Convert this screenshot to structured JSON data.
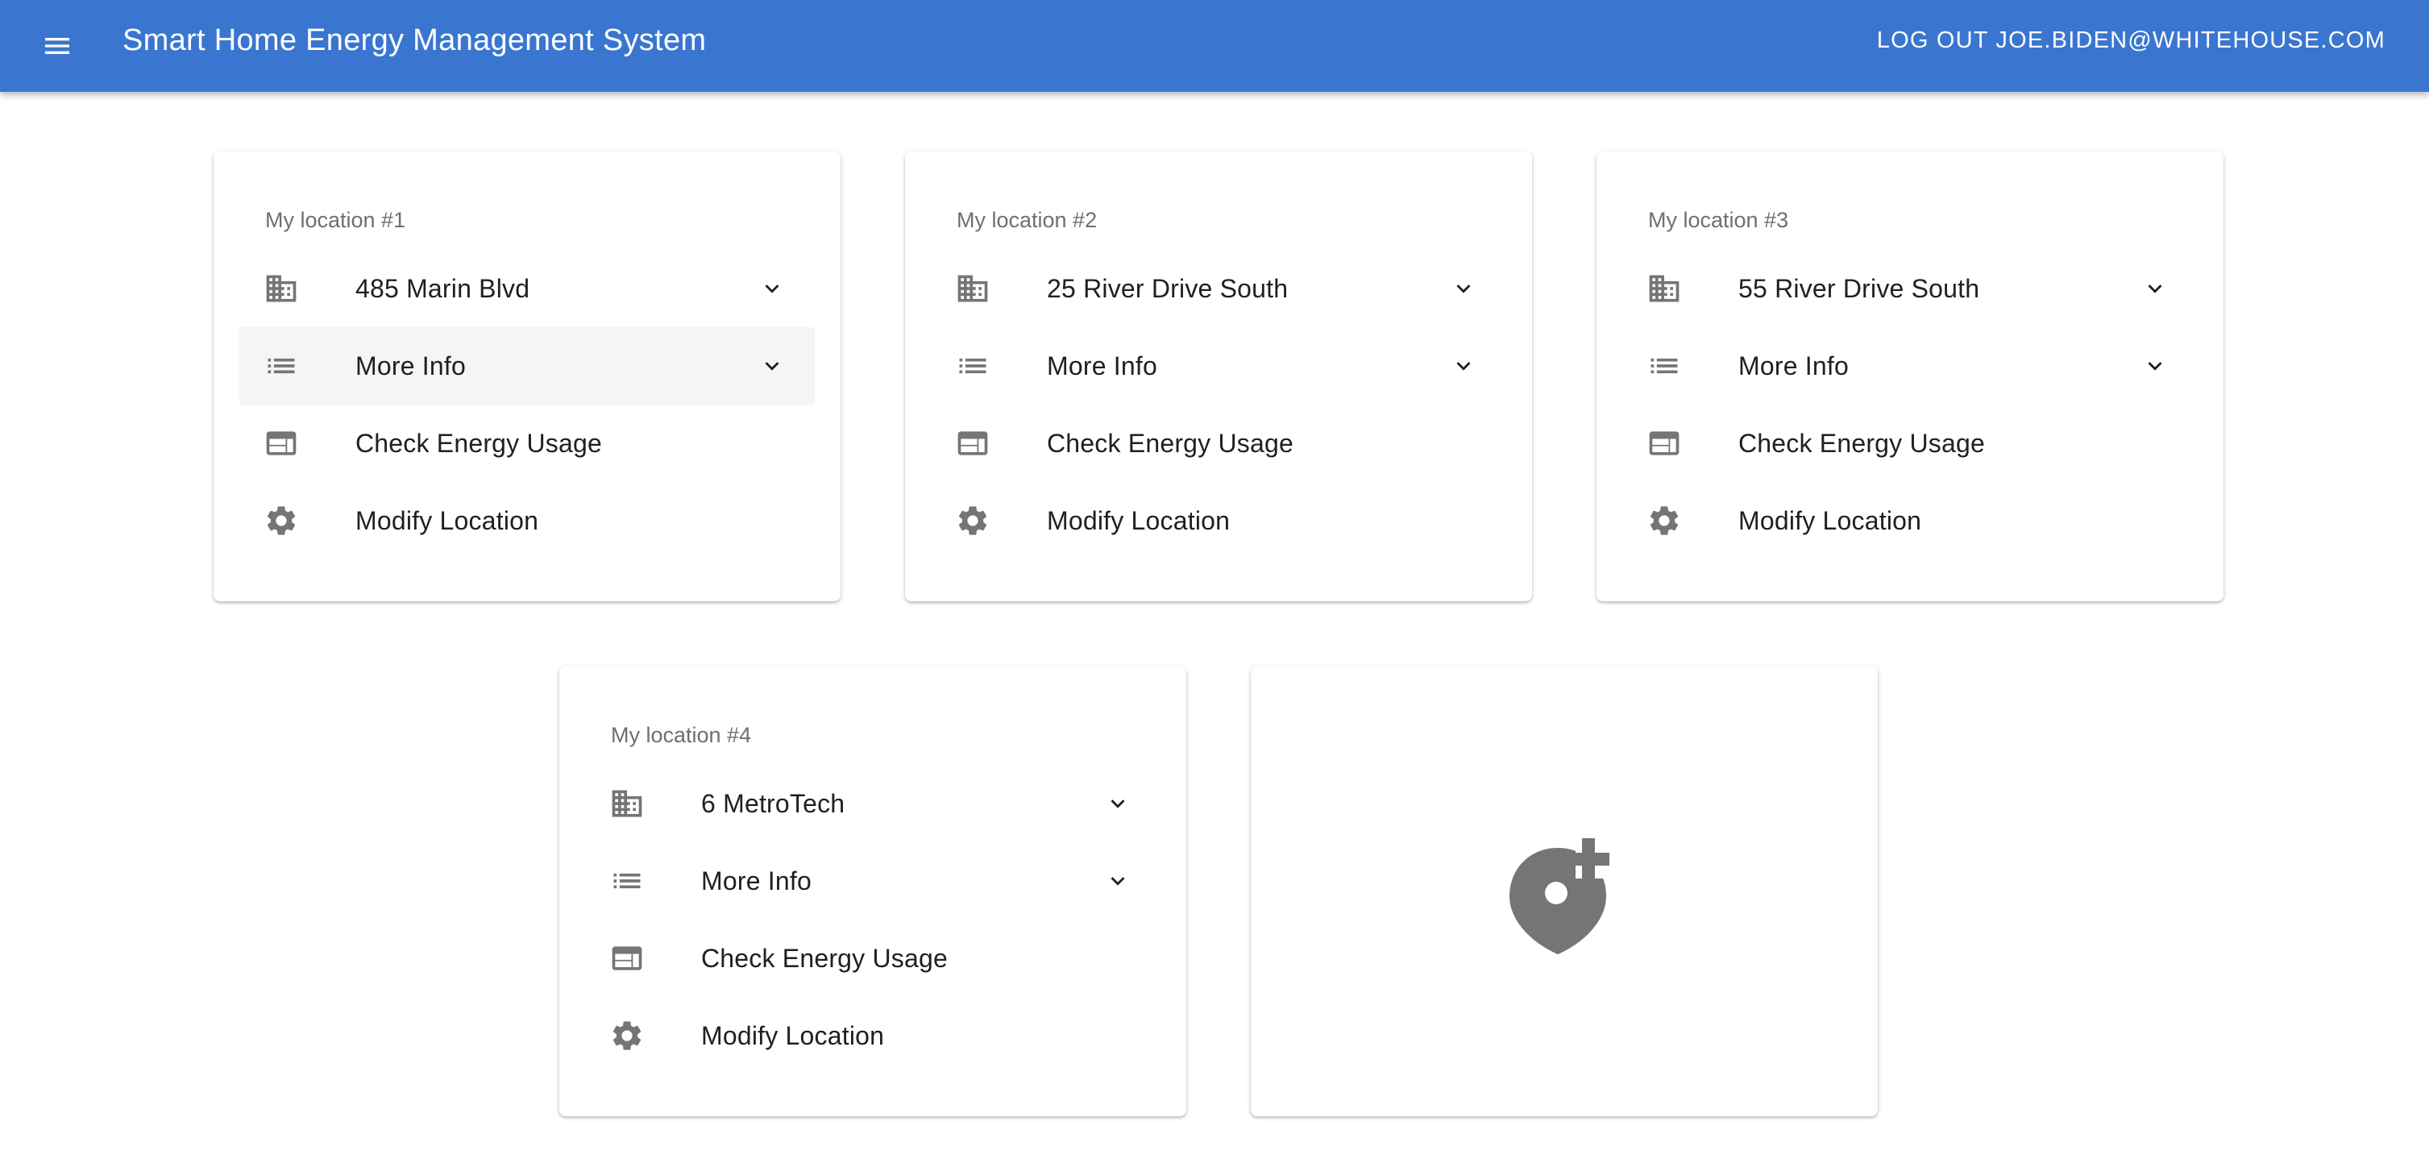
{
  "app": {
    "title": "Smart Home Energy Management System",
    "logout_label": "LOG OUT",
    "user_email": "JOE.BIDEN@WHITEHOUSE.COM"
  },
  "colors": {
    "appbar": "#3a76cf",
    "icon": "#757575",
    "card_title": "#6f6f6f",
    "active_row": "#f5f5f5"
  },
  "icons": {
    "menu": "menu-icon",
    "address": "building-icon",
    "more_info": "list-icon",
    "energy": "web-panel-icon",
    "modify": "gear-icon",
    "expand": "chevron-down-icon",
    "add_location": "add-location-icon"
  },
  "cards": [
    {
      "title": "My location #1",
      "address": "485 Marin Blvd",
      "more_info": "More Info",
      "check_energy": "Check Energy Usage",
      "modify": "Modify Location"
    },
    {
      "title": "My location #2",
      "address": "25 River Drive South",
      "more_info": "More Info",
      "check_energy": "Check Energy Usage",
      "modify": "Modify Location"
    },
    {
      "title": "My location #3",
      "address": "55 River Drive South",
      "more_info": "More Info",
      "check_energy": "Check Energy Usage",
      "modify": "Modify Location"
    },
    {
      "title": "My location #4",
      "address": "6 MetroTech",
      "more_info": "More Info",
      "check_energy": "Check Energy Usage",
      "modify": "Modify Location"
    }
  ]
}
